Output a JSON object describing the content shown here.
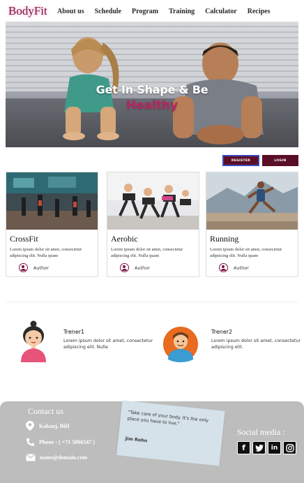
{
  "brand": {
    "logo": "BodyFit"
  },
  "nav": {
    "items": [
      {
        "label": "About us"
      },
      {
        "label": "Schedule"
      },
      {
        "label": "Program"
      },
      {
        "label": "Training"
      },
      {
        "label": "Calculator"
      },
      {
        "label": "Recipes"
      }
    ]
  },
  "hero": {
    "title": "Get In Shape & Be",
    "subtitle": "Healthy"
  },
  "auth": {
    "register_label": "REGISTER",
    "login_label": "LOGIN"
  },
  "cards": [
    {
      "title": "CrossFit",
      "text": "Lorem ipsum dolor sit amet, consectetur adipiscing elit. Nulla quam",
      "author": "Author"
    },
    {
      "title": "Aerobic",
      "text": "Lorem ipsum dolor sit amet, consectetur adipiscing elit. Nulla quam",
      "author": "Author"
    },
    {
      "title": "Running",
      "text": "Lorem ipsum dolor sit amet, consectetur adipiscing elit. Nulla quam",
      "author": "Author"
    }
  ],
  "trainers": [
    {
      "name": "Trener1",
      "text": "Lorem ipsum dolor sit amet, consectetur adipiscing elit. Nulla"
    },
    {
      "name": "Trener2",
      "text": "Lorem ipsum dolor sit amet, consectetur adipiscing elit."
    }
  ],
  "footer": {
    "contact_title": "Contact us",
    "address": "Kakanj, BiH",
    "phone": "Phone : ( +71 5896547 )",
    "email": "name@domain.com",
    "quote": "\"Take care of your body. It's the only place you have to live.\"",
    "quote_author": "Jim Rohn",
    "social_title": "Social media :",
    "social_icons": [
      "facebook-icon",
      "twitter-icon",
      "linkedin-icon",
      "instagram-icon"
    ]
  },
  "colors": {
    "accent": "#5a0f27",
    "logo": "#7a1a4a",
    "hero_subtitle": "#b8255f",
    "footer_bg": "#bdbdbd",
    "note_bg": "#d5e2ea"
  }
}
